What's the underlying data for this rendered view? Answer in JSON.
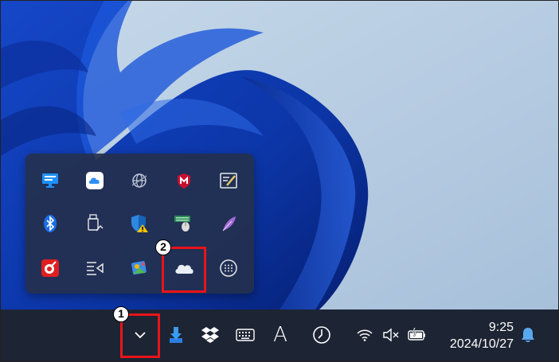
{
  "taskbar": {
    "clock": {
      "time": "9:25",
      "date": "2024/10/27"
    },
    "pinned_text_icon": "A",
    "icons": [
      "chevron-up-icon",
      "download-arrow-icon",
      "dropbox-icon",
      "keyboard-icon",
      "text-a-icon",
      "clock-icon",
      "wifi-icon",
      "speaker-muted-icon",
      "battery-charging-icon",
      "bell-icon"
    ]
  },
  "overflow_panel": {
    "rows": [
      [
        "monitor-icon",
        "cloud-icon",
        "globe-icon",
        "mcafee-icon",
        "pen-tablet-icon"
      ],
      [
        "bluetooth-icon",
        "usb-eject-icon",
        "defender-warning-icon",
        "keyboard-mouse-icon",
        "feather-icon"
      ],
      [
        "red-app-icon",
        "speech-lines-icon",
        "colorful-app-icon",
        "onedrive-icon",
        "touch-keypad-icon"
      ]
    ]
  },
  "annotations": [
    {
      "number": "1",
      "target": "show-hidden-icons-button"
    },
    {
      "number": "2",
      "target": "onedrive-icon"
    }
  ],
  "colors": {
    "taskbar_bg": "#1d2433",
    "panel_bg": "#24304e",
    "highlight": "#e8141a",
    "wallpaper_bg": "#b9cfe2",
    "bloom_blue": "#0f3bb0"
  }
}
